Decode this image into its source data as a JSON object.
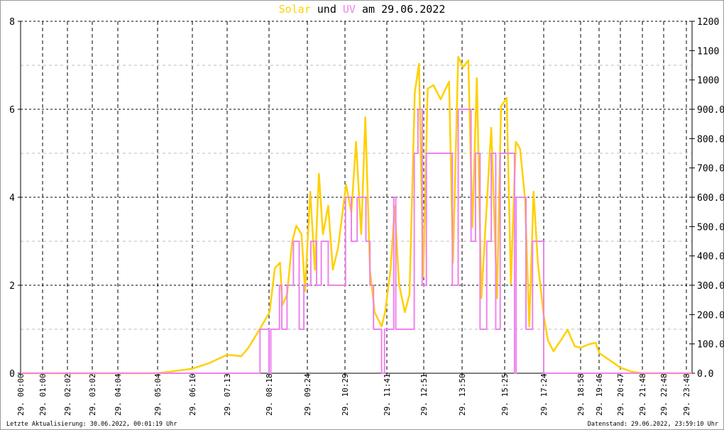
{
  "title": {
    "solar": "Solar",
    "und": "und",
    "uv": "UV",
    "rest": "am 29.06.2022"
  },
  "footer": {
    "left": "Letzte Aktualisierung: 30.06.2022, 00:01:19 Uhr",
    "right": "Datenstand: 29.06.2022, 23:59:10 Uhr"
  },
  "colors": {
    "solar": "#ffd000",
    "uv": "#ee82ee",
    "grid": "#000000",
    "minor_grid": "#bbbbbb"
  },
  "chart_data": {
    "type": "line",
    "title": "Solar und UV am 29.06.2022",
    "left_axis": {
      "series": "UV",
      "range": [
        0,
        8
      ],
      "ticks": [
        "0",
        "2",
        "4",
        "6",
        "8"
      ]
    },
    "right_axis": {
      "series": "Solar",
      "range": [
        0,
        1200
      ],
      "ticks": [
        "0.0",
        "100.0",
        "200.0",
        "300.0",
        "400.0",
        "500.0",
        "600.0",
        "700.0",
        "800.0",
        "900.0",
        "1000",
        "1100",
        "1200"
      ]
    },
    "x_ticks": [
      "29. 00:00",
      "29. 01:00",
      "29. 02:02",
      "29. 03:02",
      "29. 04:04",
      "29. 05:04",
      "29. 06:10",
      "29. 07:13",
      "29. 08:18",
      "29. 09:24",
      "29. 10:29",
      "29. 11:41",
      "29. 12:51",
      "29. 13:50",
      "29. 15:25",
      "29. 17:24",
      "29. 18:58",
      "29. 19:46",
      "29. 20:47",
      "29. 21:48",
      "29. 22:48",
      "29. 23:48"
    ],
    "series": [
      {
        "name": "Solar",
        "axis": "right",
        "points": [
          [
            "00:00",
            0
          ],
          [
            "05:04",
            0
          ],
          [
            "05:35",
            7
          ],
          [
            "06:09",
            15
          ],
          [
            "06:40",
            34
          ],
          [
            "07:13",
            63
          ],
          [
            "07:35",
            58
          ],
          [
            "07:46",
            87
          ],
          [
            "08:03",
            148
          ],
          [
            "08:19",
            208
          ],
          [
            "08:28",
            358
          ],
          [
            "08:37",
            377
          ],
          [
            "08:41",
            232
          ],
          [
            "08:49",
            268
          ],
          [
            "08:58",
            450
          ],
          [
            "09:05",
            503
          ],
          [
            "09:14",
            474
          ],
          [
            "09:20",
            280
          ],
          [
            "09:29",
            619
          ],
          [
            "09:37",
            353
          ],
          [
            "09:44",
            680
          ],
          [
            "09:51",
            474
          ],
          [
            "10:00",
            571
          ],
          [
            "10:08",
            353
          ],
          [
            "10:17",
            426
          ],
          [
            "10:31",
            643
          ],
          [
            "10:40",
            547
          ],
          [
            "10:48",
            789
          ],
          [
            "10:57",
            474
          ],
          [
            "11:04",
            873
          ],
          [
            "11:12",
            353
          ],
          [
            "11:20",
            208
          ],
          [
            "11:32",
            160
          ],
          [
            "11:38",
            208
          ],
          [
            "11:48",
            353
          ],
          [
            "11:56",
            571
          ],
          [
            "12:04",
            305
          ],
          [
            "12:15",
            208
          ],
          [
            "12:24",
            268
          ],
          [
            "12:34",
            958
          ],
          [
            "12:42",
            1055
          ],
          [
            "12:50",
            329
          ],
          [
            "12:57",
            970
          ],
          [
            "13:06",
            982
          ],
          [
            "13:17",
            934
          ],
          [
            "13:30",
            994
          ],
          [
            "13:36",
            377
          ],
          [
            "13:44",
            1079
          ],
          [
            "13:52",
            1043
          ],
          [
            "14:04",
            1067
          ],
          [
            "14:13",
            498
          ],
          [
            "14:23",
            1006
          ],
          [
            "14:33",
            256
          ],
          [
            "14:44",
            547
          ],
          [
            "14:55",
            837
          ],
          [
            "15:08",
            256
          ],
          [
            "15:17",
            910
          ],
          [
            "15:31",
            939
          ],
          [
            "15:44",
            305
          ],
          [
            "15:59",
            789
          ],
          [
            "16:12",
            765
          ],
          [
            "16:27",
            595
          ],
          [
            "16:40",
            160
          ],
          [
            "16:53",
            619
          ],
          [
            "17:06",
            377
          ],
          [
            "17:24",
            196
          ],
          [
            "17:35",
            111
          ],
          [
            "17:49",
            75
          ],
          [
            "18:07",
            111
          ],
          [
            "18:25",
            148
          ],
          [
            "18:43",
            92
          ],
          [
            "18:58",
            87
          ],
          [
            "19:20",
            99
          ],
          [
            "19:37",
            104
          ],
          [
            "19:47",
            68
          ],
          [
            "20:17",
            44
          ],
          [
            "20:47",
            19
          ],
          [
            "21:19",
            5
          ],
          [
            "21:48",
            0
          ],
          [
            "23:59",
            0
          ]
        ]
      },
      {
        "name": "UV",
        "axis": "left",
        "step": true,
        "points": [
          [
            "00:00",
            0
          ],
          [
            "08:04",
            1
          ],
          [
            "08:18",
            0
          ],
          [
            "08:21",
            1
          ],
          [
            "08:36",
            2
          ],
          [
            "08:40",
            1
          ],
          [
            "08:49",
            2
          ],
          [
            "09:00",
            3
          ],
          [
            "09:10",
            1
          ],
          [
            "09:18",
            2
          ],
          [
            "09:30",
            3
          ],
          [
            "09:40",
            2
          ],
          [
            "09:48",
            3
          ],
          [
            "10:00",
            2
          ],
          [
            "10:30",
            4
          ],
          [
            "10:40",
            3
          ],
          [
            "10:50",
            4
          ],
          [
            "11:05",
            3
          ],
          [
            "11:12",
            2
          ],
          [
            "11:18",
            1
          ],
          [
            "11:32",
            0
          ],
          [
            "11:37",
            1
          ],
          [
            "11:54",
            4
          ],
          [
            "11:58",
            1
          ],
          [
            "12:33",
            5
          ],
          [
            "12:40",
            6
          ],
          [
            "12:48",
            2
          ],
          [
            "12:55",
            5
          ],
          [
            "13:35",
            2
          ],
          [
            "13:44",
            6
          ],
          [
            "14:10",
            3
          ],
          [
            "14:20",
            5
          ],
          [
            "14:30",
            1
          ],
          [
            "14:45",
            3
          ],
          [
            "14:55",
            5
          ],
          [
            "15:05",
            1
          ],
          [
            "15:15",
            5
          ],
          [
            "15:55",
            0
          ],
          [
            "16:00",
            4
          ],
          [
            "16:30",
            1
          ],
          [
            "16:50",
            3
          ],
          [
            "17:24",
            0
          ],
          [
            "23:59",
            0
          ]
        ]
      }
    ]
  }
}
